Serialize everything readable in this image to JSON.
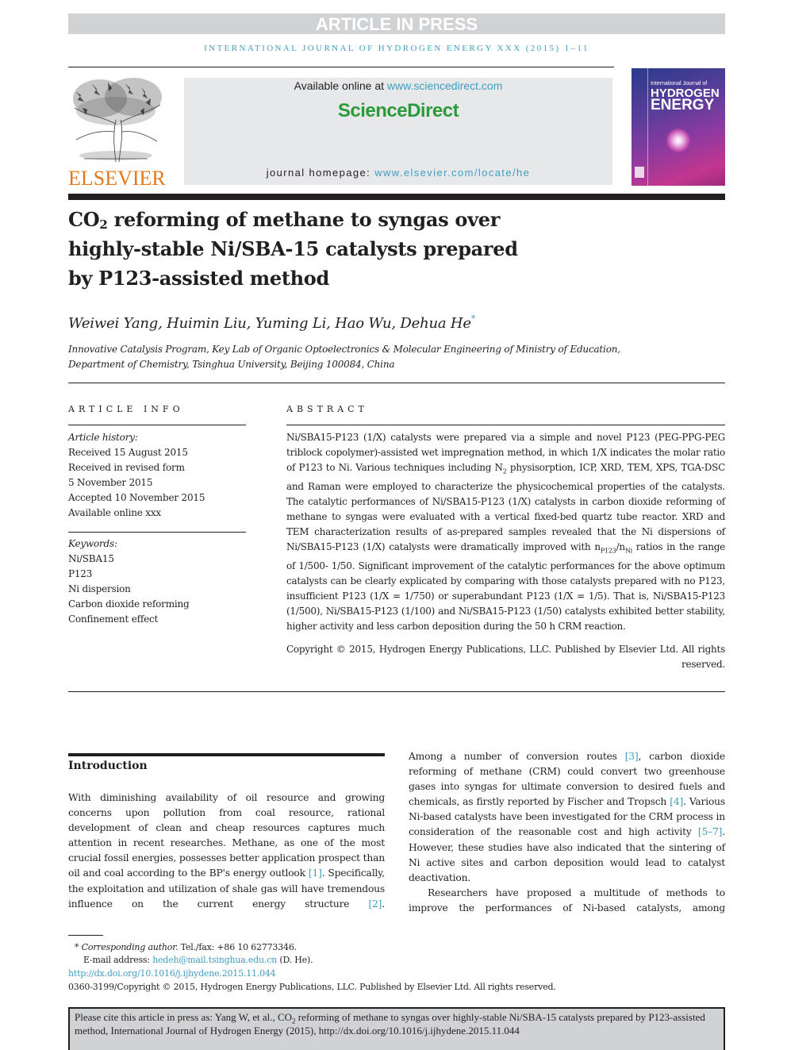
{
  "banner": {
    "label": "ARTICLE IN PRESS"
  },
  "journal_running_head": "INTERNATIONAL JOURNAL OF HYDROGEN ENERGY XXX (2015) 1–11",
  "masthead": {
    "publisher_logo_text": "ELSEVIER",
    "available_prefix": "Available online at ",
    "available_link": "www.sciencedirect.com",
    "brand": "ScienceDirect",
    "homepage_prefix": "journal homepage: ",
    "homepage_link": "www.elsevier.com/locate/he",
    "cover": {
      "line1": "International Journal of",
      "line2": "HYDROGEN",
      "line3": "ENERGY"
    }
  },
  "article": {
    "title_prefix": "CO",
    "title_sub": "2",
    "title_line1_rest": " reforming of methane to syngas over",
    "title_line2": "highly-stable Ni/SBA-15 catalysts prepared",
    "title_line3": "by P123-assisted method",
    "authors": "Weiwei Yang, Huimin Liu, Yuming Li, Hao Wu, Dehua He",
    "corresponding_marker": "*",
    "affiliation_line1": "Innovative Catalysis Program, Key Lab of Organic Optoelectronics & Molecular Engineering of Ministry of Education,",
    "affiliation_line2": "Department of Chemistry, Tsinghua University, Beijing 100084, China"
  },
  "article_info": {
    "heading": "ARTICLE INFO",
    "history_label": "Article history:",
    "history": [
      "Received 15 August 2015",
      "Received in revised form",
      "5 November 2015",
      "Accepted 10 November 2015",
      "Available online xxx"
    ],
    "keywords_label": "Keywords:",
    "keywords": [
      "Ni/SBA15",
      "P123",
      "Ni dispersion",
      "Carbon dioxide reforming",
      "Confinement effect"
    ]
  },
  "abstract": {
    "heading": "ABSTRACT",
    "part1": "Ni/SBA15-P123 (1/X) catalysts were prepared via a simple and novel P123 (PEG-PPG-PEG triblock copolymer)-assisted wet impregnation method, in which 1/X indicates the molar ratio of P123 to Ni. Various techniques including N",
    "n2_sub": "2",
    "part2": " physisorption, ICP, XRD, TEM, XPS, TGA-DSC and Raman were employed to characterize the physicochemical properties of the catalysts. The catalytic performances of Ni/SBA15-P123 (1/X) catalysts in carbon dioxide reforming of methane to syngas were evaluated with a vertical fixed-bed quartz tube reactor. XRD and TEM characterization results of as-prepared samples revealed that the Ni dispersions of Ni/SBA15-P123 (1/X) catalysts were dramatically improved with n",
    "sub_p123": "P123",
    "slash_n": "/n",
    "sub_ni": "Ni",
    "part3": " ratios in the range of 1/500- 1/50. Significant improvement of the catalytic performances for the above optimum catalysts can be clearly explicated by comparing with those catalysts prepared with no P123, insufficient P123 (1/X = 1/750) or superabundant P123 (1/X = 1/5). That is, Ni/SBA15-P123 (1/500), Ni/SBA15-P123 (1/100) and Ni/SBA15-P123 (1/50) catalysts exhibited better stability, higher activity and less carbon deposition during the 50 h CRM reaction.",
    "copyright_line1": "Copyright © 2015, Hydrogen Energy Publications, LLC. Published by Elsevier Ltd. All rights",
    "copyright_line2": "reserved."
  },
  "introduction": {
    "heading": "Introduction",
    "left_p1_a": "With diminishing availability of oil resource and growing concerns upon pollution from coal resource, rational development of clean and cheap resources captures much attention in recent researches. Methane, as one of the most crucial fossil energies, possesses better application prospect than oil and coal according to the BP's energy outlook ",
    "ref1": "[1]",
    "left_p1_b": ". Specifically, the exploitation and utilization of shale gas will have tremendous influence on the current energy structure ",
    "ref2": "[2]",
    "left_p1_c": ".",
    "right_p1_a": "Among a number of conversion routes ",
    "ref3": "[3]",
    "right_p1_b": ", carbon dioxide reforming of methane (CRM) could convert two greenhouse gases into syngas for ultimate conversion to desired fuels and chemicals, as firstly reported by Fischer and Tropsch ",
    "ref4": "[4]",
    "right_p1_c": ". Various Ni-based catalysts have been investigated for the CRM process in consideration of the reasonable cost and high activity ",
    "ref5_7": "[5–7]",
    "right_p1_d": ". However, these studies have also indicated that the sintering of Ni active sites and carbon deposition would lead to catalyst deactivation.",
    "right_p2": "Researchers have proposed a multitude of methods to improve the performances of Ni-based catalysts, among"
  },
  "footnotes": {
    "corresponding_marker": "*",
    "corresponding_label": "Corresponding author.",
    "tel": " Tel./fax: +86 10 62773346.",
    "email_label": "E-mail address: ",
    "email": "hedeh@mail.tsinghua.edu.cn",
    "email_suffix": " (D. He).",
    "doi": "http://dx.doi.org/10.1016/j.ijhydene.2015.11.044",
    "issn_copyright": "0360-3199/Copyright © 2015, Hydrogen Energy Publications, LLC. Published by Elsevier Ltd. All rights reserved."
  },
  "cite_box": {
    "prefix": "Please cite this article in press as: Yang W, et al., CO",
    "sub": "2",
    "rest": " reforming of methane to syngas over highly-stable Ni/SBA-15 catalysts prepared by P123-assisted method, International Journal of Hydrogen Energy (2015), http://dx.doi.org/10.1016/j.ijhydene.2015.11.044"
  },
  "colors": {
    "link_blue": "#3f9ec2",
    "elsevier_orange": "#e77817",
    "sciencedirect_green": "#2a9a3a",
    "banner_gray": "#d1d2d4"
  }
}
